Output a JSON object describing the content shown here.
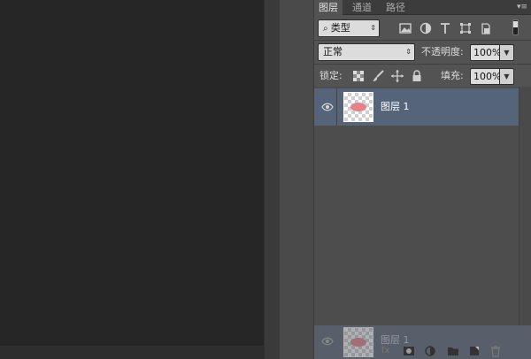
{
  "panel": {
    "tabs": [
      {
        "label": "图层",
        "active": true
      },
      {
        "label": "通道",
        "active": false
      },
      {
        "label": "路径",
        "active": false
      }
    ],
    "menu_icon": "panel-menu-icon"
  },
  "filter": {
    "kind_label": "类型",
    "icons": [
      "image-filter-icon",
      "adjustment-filter-icon",
      "type-filter-icon",
      "shape-filter-icon",
      "smart-object-filter-icon"
    ]
  },
  "blend": {
    "mode": "正常",
    "opacity_label": "不透明度:",
    "opacity_value": "100%"
  },
  "lock": {
    "label": "锁定:",
    "icons": [
      "lock-transparent-pixels-icon",
      "lock-image-pixels-icon",
      "lock-position-icon",
      "lock-all-icon"
    ],
    "fill_label": "填充:",
    "fill_value": "100%"
  },
  "layers": [
    {
      "name": "图层 1",
      "visible": true,
      "selected": true
    }
  ],
  "drag_ghost": {
    "name": "图层 1"
  },
  "bottom_icons": [
    "fx-icon",
    "add-mask-icon",
    "adjustment-layer-icon",
    "new-group-icon",
    "new-layer-icon",
    "delete-layer-icon"
  ],
  "colors": {
    "selected_row": "#56647a",
    "panel_bg": "#535353",
    "canvas_bg": "#262626",
    "thumb_content": "#e7828b"
  }
}
